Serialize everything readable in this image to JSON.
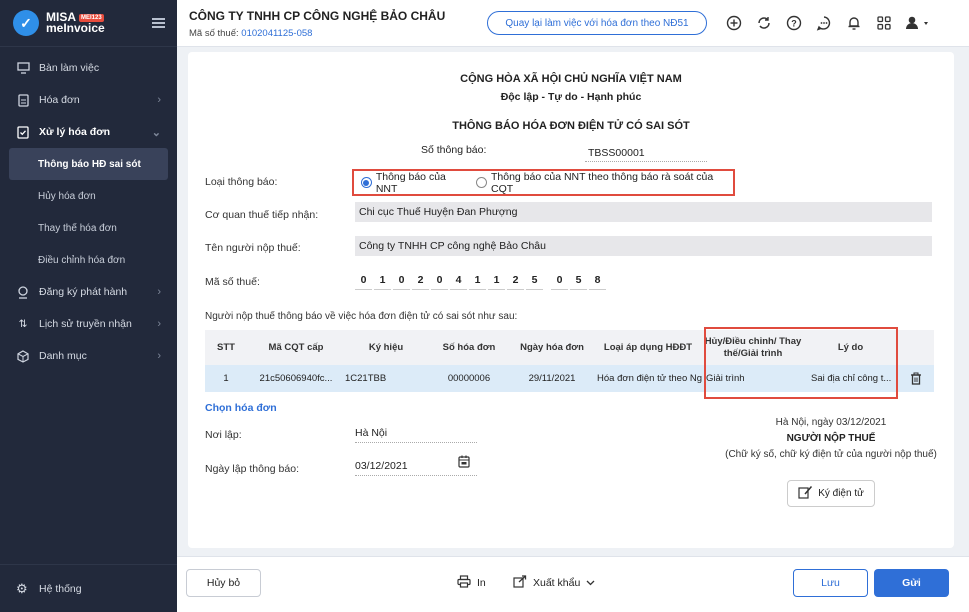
{
  "sidebar": {
    "brand_line1": "MISA",
    "brand_badge": "MEI123",
    "brand_line2": "meInvoice",
    "items": [
      {
        "label": "Bàn làm việc"
      },
      {
        "label": "Hóa đơn"
      },
      {
        "label": "Xử lý hóa đơn"
      },
      {
        "label": "Đăng ký phát hành"
      },
      {
        "label": "Lịch sử truyền nhận"
      },
      {
        "label": "Danh mục"
      }
    ],
    "sub_items": [
      {
        "label": "Thông báo HĐ sai sót"
      },
      {
        "label": "Hủy hóa đơn"
      },
      {
        "label": "Thay thế hóa đơn"
      },
      {
        "label": "Điều chỉnh hóa đơn"
      }
    ],
    "bottom": "Hệ thống"
  },
  "header": {
    "company": "CÔNG TY TNHH CP CÔNG NGHỆ BẢO CHÂU",
    "tax_label": "Mã số thuế:",
    "tax_code": "0102041125-058",
    "back_button": "Quay lại làm việc với hóa đơn theo NĐ51"
  },
  "form": {
    "nation": "CỘNG HÒA XÃ HỘI CHỦ NGHĨA VIỆT NAM",
    "motto": "Độc lập - Tự do - Hạnh phúc",
    "title": "THÔNG BÁO HÓA ĐƠN ĐIỆN TỬ CÓ SAI SÓT",
    "notice_no_label": "Số thông báo:",
    "notice_no": "TBSS00001",
    "type_label": "Loại thông báo:",
    "type_option1": "Thông báo của NNT",
    "type_option2": "Thông báo của NNT theo thông báo rà soát của CQT",
    "tax_office_label": "Cơ quan thuế tiếp nhận:",
    "tax_office": "Chi cục Thuế Huyện Đan Phượng",
    "taxpayer_label": "Tên người nộp thuế:",
    "taxpayer": "Công ty TNHH CP công nghệ Bảo Châu",
    "tax_code_label": "Mã số thuế:",
    "tax_digits": [
      "0",
      "1",
      "0",
      "2",
      "0",
      "4",
      "1",
      "1",
      "2",
      "5",
      "0",
      "5",
      "8"
    ],
    "table_intro": "Người nộp thuế thông báo về việc hóa đơn điện tử có sai sót như sau:",
    "columns": [
      "STT",
      "Mã CQT cấp",
      "Ký hiệu",
      "Số hóa đơn",
      "Ngày hóa đơn",
      "Loại áp dụng HĐĐT",
      "Hủy/Điều chỉnh/ Thay thế/Giải trình",
      "Lý do"
    ],
    "rows": [
      [
        "1",
        "21c50606940fc...",
        "1C21TBB",
        "00000006",
        "29/11/2021",
        "Hóa đơn điện tử theo Ng",
        "Giải trình",
        "Sai địa chỉ công t..."
      ]
    ],
    "choose_invoice": "Chọn hóa đơn",
    "place_label": "Nơi lập:",
    "place": "Hà Nội",
    "date_label": "Ngày lập thông báo:",
    "date": "03/12/2021",
    "sign_date": "Hà Nội, ngày 03/12/2021",
    "sign_title": "NGƯỜI NỘP THUẾ",
    "sign_note": "(Chữ ký số, chữ ký điện tử của người nộp thuế)",
    "sign_button": "Ký điện tử"
  },
  "footer": {
    "cancel": "Hủy bỏ",
    "print": "In",
    "export": "Xuất khẩu",
    "save": "Lưu",
    "send": "Gửi"
  }
}
